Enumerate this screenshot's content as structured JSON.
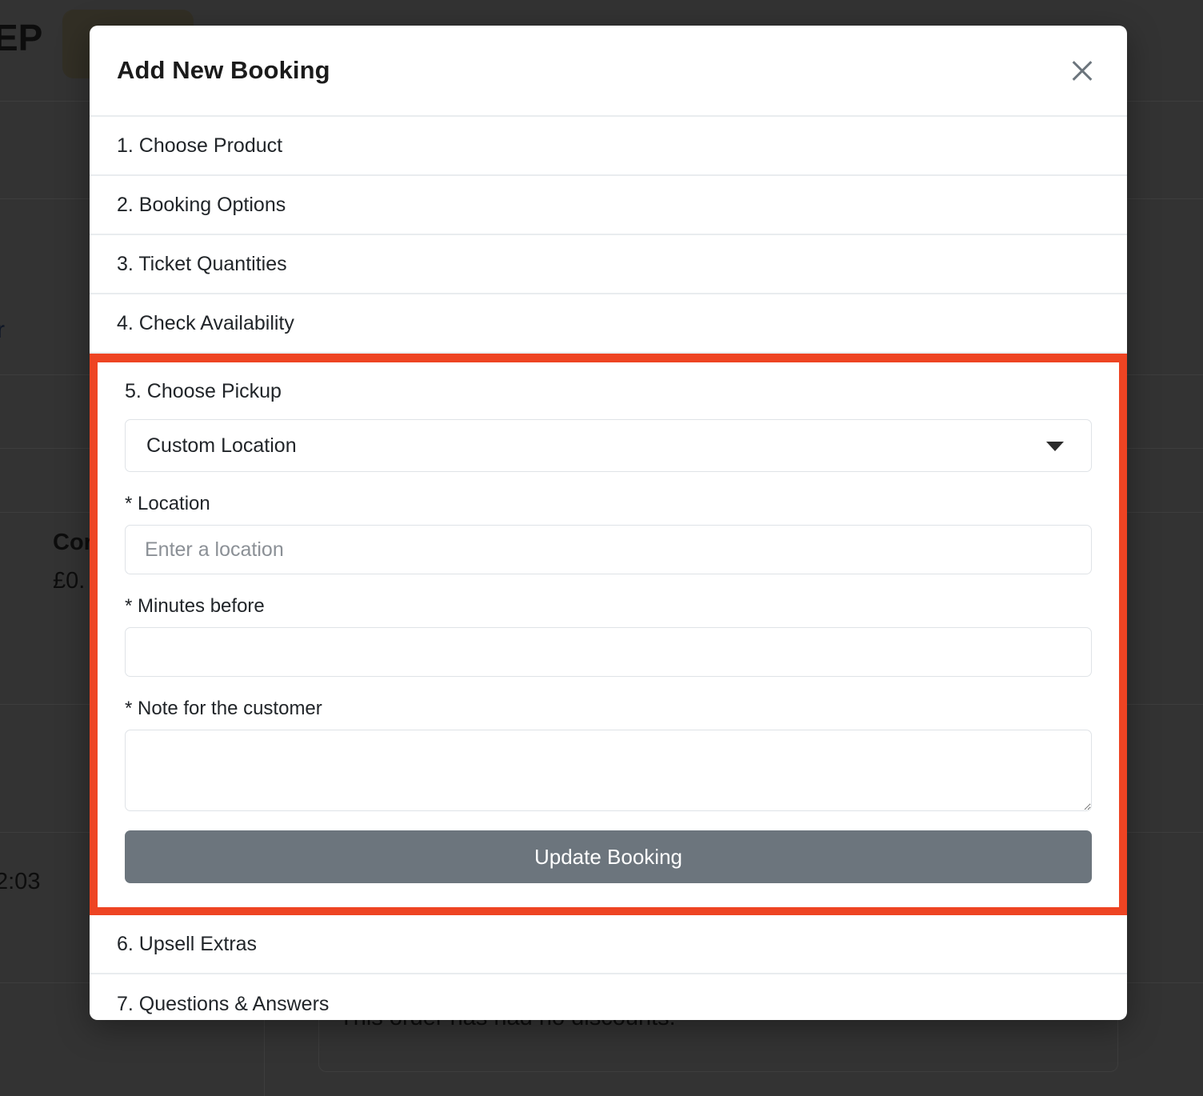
{
  "background": {
    "partial_label": "EP",
    "side_fragment": "r",
    "table_header_fragment": "Cor",
    "table_value_fragment": "£0.",
    "time_fragment": "2:03",
    "discount_note": "This order has had no discounts.",
    "page_bg_color": "#333333",
    "chip_color": "#322f25"
  },
  "modal": {
    "title": "Add New Booking",
    "close_icon": "close-icon",
    "sections_before": [
      {
        "label": "1. Choose Product"
      },
      {
        "label": "2. Booking Options"
      },
      {
        "label": "3. Ticket Quantities"
      },
      {
        "label": "4. Check Availability"
      }
    ],
    "open_section": {
      "title": "5. Choose Pickup",
      "highlight_color": "#ee4423",
      "pickup_select": {
        "selected": "Custom Location",
        "caret_icon": "chevron-down-icon"
      },
      "fields": [
        {
          "label": "* Location",
          "type": "text",
          "value": "",
          "placeholder": "Enter a location"
        },
        {
          "label": "* Minutes before",
          "type": "text",
          "value": "",
          "placeholder": ""
        },
        {
          "label": "* Note for the customer",
          "type": "textarea",
          "value": "",
          "placeholder": ""
        }
      ],
      "submit_label": "Update Booking",
      "submit_color": "#6c757d"
    },
    "sections_after": [
      {
        "label": "6. Upsell Extras"
      },
      {
        "label": "7. Questions & Answers"
      }
    ]
  }
}
